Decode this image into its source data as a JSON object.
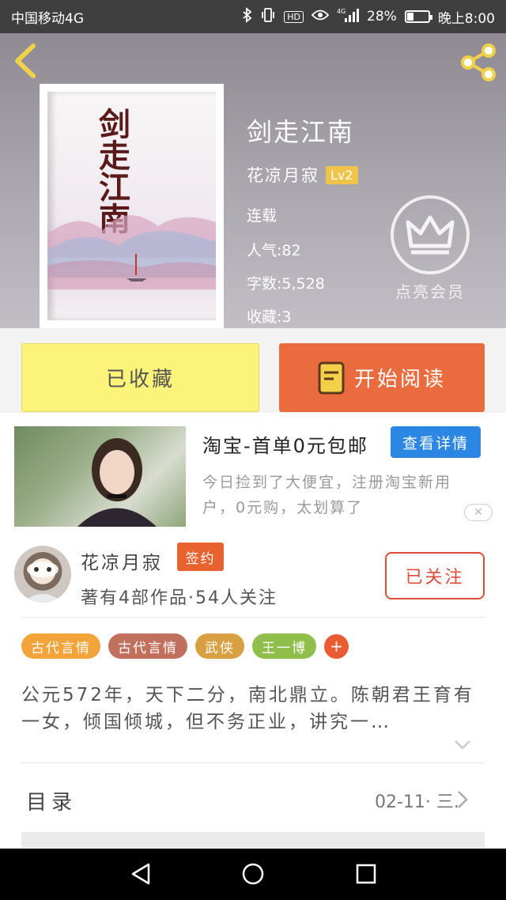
{
  "status_bar": {
    "carrier": "中国移动4G",
    "battery": "28%",
    "battery_level": 0.28,
    "time": "晚上8:00",
    "icons": [
      "bluetooth-icon",
      "vibrate-icon",
      "hd-icon",
      "eye-icon",
      "signal-icon",
      "battery-icon"
    ],
    "hd": "HD",
    "net": "4G"
  },
  "header": {
    "back_icon": "back-arrow-icon",
    "share_icon": "share-icon",
    "book_title": "剑走江南",
    "author": "花凉月寂",
    "level": "Lv2",
    "status": "连载",
    "popularity": "人气:82",
    "word_count": "字数:5,528",
    "favorites": "收藏:3",
    "cover_title": "剑走江南",
    "vip_label": "点亮会员",
    "vip_icon": "crown-icon"
  },
  "actions": {
    "collect_label": "已收藏",
    "read_label": "开始阅读",
    "read_icon": "book-icon"
  },
  "ad": {
    "title": "淘宝-首单0元包邮",
    "detail_button": "查看详情",
    "description": "今日捡到了大便宜，注册淘宝新用户，0元购，太划算了",
    "close_icon": "close-icon"
  },
  "author_section": {
    "name": "花凉月寂",
    "badge": "签约",
    "stats": "著有4部作品·54人关注",
    "follow_button": "已关注"
  },
  "tags": [
    {
      "label": "古代言情",
      "color": "#f2a33a"
    },
    {
      "label": "古代言情",
      "color": "#c0705c"
    },
    {
      "label": "武侠",
      "color": "#d9a043"
    },
    {
      "label": "王一博",
      "color": "#8fbf4a"
    }
  ],
  "tag_add": "+",
  "synopsis": "公元572年，天下二分，南北鼎立。陈朝君王育有一女，倾国倾城，但不务正业，讲究一…",
  "toc": {
    "label": "目录",
    "update": "02-11· 三."
  },
  "nav_bar": {
    "icons": [
      "nav-back-icon",
      "nav-home-icon",
      "nav-recents-icon"
    ]
  }
}
